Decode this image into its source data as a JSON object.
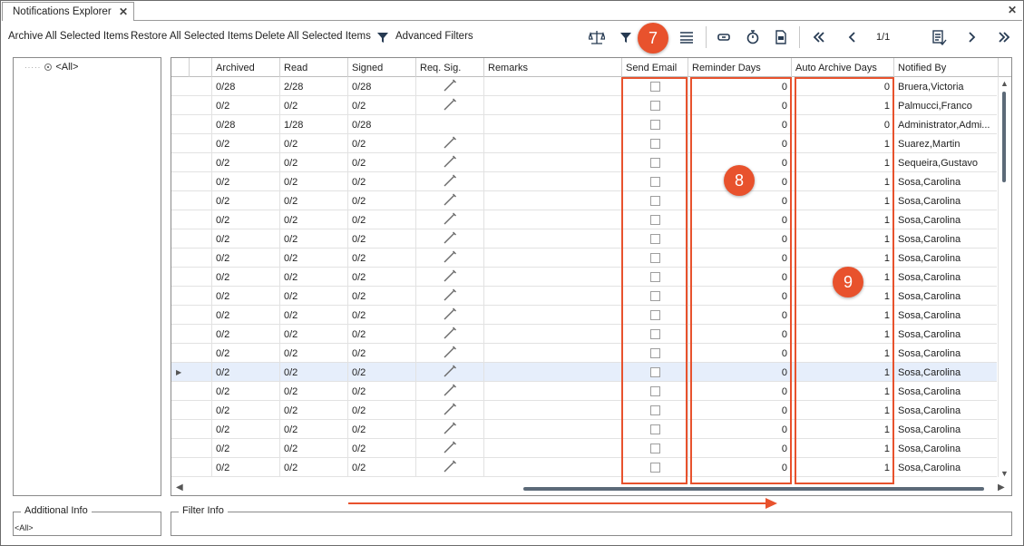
{
  "tab": {
    "title": "Notifications Explorer",
    "close": "✕"
  },
  "toolbar": {
    "archive_label": "Archive All Selected Items",
    "restore_label": "Restore All Selected Items",
    "delete_label": "Delete All Selected Items",
    "advanced_filters_label": "Advanced Filters",
    "page_indicator": "1/1"
  },
  "tree": {
    "root_label": "<All>"
  },
  "grid": {
    "columns": [
      "Archived",
      "Read",
      "Signed",
      "Req. Sig.",
      "Remarks",
      "Send Email",
      "Reminder Days",
      "Auto Archive Days",
      "Notified By"
    ],
    "rows": [
      {
        "archived": "0/28",
        "read": "2/28",
        "signed": "0/28",
        "req_sig": true,
        "remarks": "",
        "send_email": false,
        "reminder_days": "0",
        "auto_archive_days": "0",
        "notified_by": "Bruera,Victoria"
      },
      {
        "archived": "0/2",
        "read": "0/2",
        "signed": "0/2",
        "req_sig": true,
        "remarks": "",
        "send_email": false,
        "reminder_days": "0",
        "auto_archive_days": "1",
        "notified_by": "Palmucci,Franco"
      },
      {
        "archived": "0/28",
        "read": "1/28",
        "signed": "0/28",
        "req_sig": false,
        "remarks": "",
        "send_email": false,
        "reminder_days": "0",
        "auto_archive_days": "0",
        "notified_by": "Administrator,Admi..."
      },
      {
        "archived": "0/2",
        "read": "0/2",
        "signed": "0/2",
        "req_sig": true,
        "remarks": "",
        "send_email": false,
        "reminder_days": "0",
        "auto_archive_days": "1",
        "notified_by": "Suarez,Martin"
      },
      {
        "archived": "0/2",
        "read": "0/2",
        "signed": "0/2",
        "req_sig": true,
        "remarks": "",
        "send_email": false,
        "reminder_days": "0",
        "auto_archive_days": "1",
        "notified_by": "Sequeira,Gustavo"
      },
      {
        "archived": "0/2",
        "read": "0/2",
        "signed": "0/2",
        "req_sig": true,
        "remarks": "",
        "send_email": false,
        "reminder_days": "0",
        "auto_archive_days": "1",
        "notified_by": "Sosa,Carolina"
      },
      {
        "archived": "0/2",
        "read": "0/2",
        "signed": "0/2",
        "req_sig": true,
        "remarks": "",
        "send_email": false,
        "reminder_days": "0",
        "auto_archive_days": "1",
        "notified_by": "Sosa,Carolina"
      },
      {
        "archived": "0/2",
        "read": "0/2",
        "signed": "0/2",
        "req_sig": true,
        "remarks": "",
        "send_email": false,
        "reminder_days": "0",
        "auto_archive_days": "1",
        "notified_by": "Sosa,Carolina"
      },
      {
        "archived": "0/2",
        "read": "0/2",
        "signed": "0/2",
        "req_sig": true,
        "remarks": "",
        "send_email": false,
        "reminder_days": "0",
        "auto_archive_days": "1",
        "notified_by": "Sosa,Carolina"
      },
      {
        "archived": "0/2",
        "read": "0/2",
        "signed": "0/2",
        "req_sig": true,
        "remarks": "",
        "send_email": false,
        "reminder_days": "0",
        "auto_archive_days": "1",
        "notified_by": "Sosa,Carolina"
      },
      {
        "archived": "0/2",
        "read": "0/2",
        "signed": "0/2",
        "req_sig": true,
        "remarks": "",
        "send_email": false,
        "reminder_days": "0",
        "auto_archive_days": "1",
        "notified_by": "Sosa,Carolina"
      },
      {
        "archived": "0/2",
        "read": "0/2",
        "signed": "0/2",
        "req_sig": true,
        "remarks": "",
        "send_email": false,
        "reminder_days": "0",
        "auto_archive_days": "1",
        "notified_by": "Sosa,Carolina"
      },
      {
        "archived": "0/2",
        "read": "0/2",
        "signed": "0/2",
        "req_sig": true,
        "remarks": "",
        "send_email": false,
        "reminder_days": "0",
        "auto_archive_days": "1",
        "notified_by": "Sosa,Carolina"
      },
      {
        "archived": "0/2",
        "read": "0/2",
        "signed": "0/2",
        "req_sig": true,
        "remarks": "",
        "send_email": false,
        "reminder_days": "0",
        "auto_archive_days": "1",
        "notified_by": "Sosa,Carolina"
      },
      {
        "archived": "0/2",
        "read": "0/2",
        "signed": "0/2",
        "req_sig": true,
        "remarks": "",
        "send_email": false,
        "reminder_days": "0",
        "auto_archive_days": "1",
        "notified_by": "Sosa,Carolina"
      },
      {
        "archived": "0/2",
        "read": "0/2",
        "signed": "0/2",
        "req_sig": true,
        "remarks": "",
        "send_email": false,
        "reminder_days": "0",
        "auto_archive_days": "1",
        "notified_by": "Sosa,Carolina",
        "selected": true
      },
      {
        "archived": "0/2",
        "read": "0/2",
        "signed": "0/2",
        "req_sig": true,
        "remarks": "",
        "send_email": false,
        "reminder_days": "0",
        "auto_archive_days": "1",
        "notified_by": "Sosa,Carolina"
      },
      {
        "archived": "0/2",
        "read": "0/2",
        "signed": "0/2",
        "req_sig": true,
        "remarks": "",
        "send_email": false,
        "reminder_days": "0",
        "auto_archive_days": "1",
        "notified_by": "Sosa,Carolina"
      },
      {
        "archived": "0/2",
        "read": "0/2",
        "signed": "0/2",
        "req_sig": true,
        "remarks": "",
        "send_email": false,
        "reminder_days": "0",
        "auto_archive_days": "1",
        "notified_by": "Sosa,Carolina"
      },
      {
        "archived": "0/2",
        "read": "0/2",
        "signed": "0/2",
        "req_sig": true,
        "remarks": "",
        "send_email": false,
        "reminder_days": "0",
        "auto_archive_days": "1",
        "notified_by": "Sosa,Carolina"
      },
      {
        "archived": "0/2",
        "read": "0/2",
        "signed": "0/2",
        "req_sig": true,
        "remarks": "",
        "send_email": false,
        "reminder_days": "0",
        "auto_archive_days": "1",
        "notified_by": "Sosa,Carolina"
      }
    ]
  },
  "callouts": {
    "seven": "7",
    "eight": "8",
    "nine": "9"
  },
  "bottom": {
    "additional_info_title": "Additional Info",
    "additional_info_value": "<All>",
    "filter_info_title": "Filter Info"
  },
  "colors": {
    "highlight": "#e8522d",
    "scroll_thumb": "#5c6a78",
    "selected_row": "#e6eefb"
  }
}
